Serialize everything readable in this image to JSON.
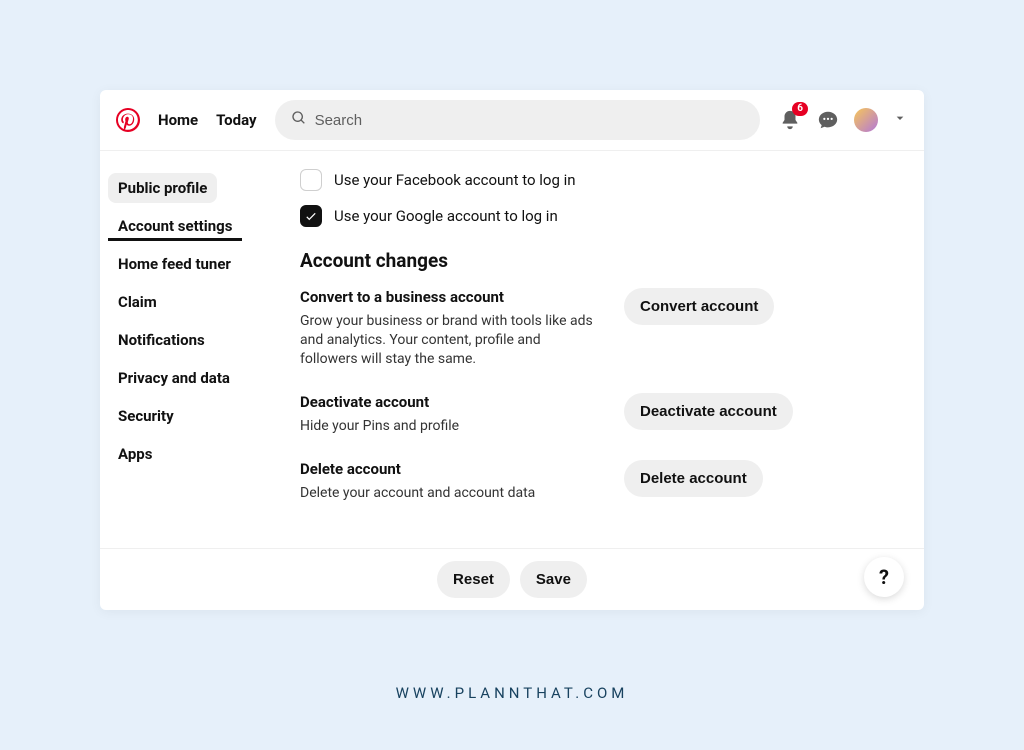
{
  "header": {
    "nav": {
      "home": "Home",
      "today": "Today"
    },
    "search_placeholder": "Search",
    "badge_count": "6"
  },
  "sidebar": {
    "items": [
      "Public profile",
      "Account settings",
      "Home feed tuner",
      "Claim",
      "Notifications",
      "Privacy and data",
      "Security",
      "Apps"
    ]
  },
  "login_options": {
    "facebook": "Use your Facebook account to log in",
    "google": "Use your Google account to log in"
  },
  "section_title": "Account changes",
  "actions": {
    "convert": {
      "title": "Convert to a business account",
      "desc": "Grow your business or brand with tools like ads and analytics. Your content, profile and followers will stay the same.",
      "button": "Convert account"
    },
    "deactivate": {
      "title": "Deactivate account",
      "desc": "Hide your Pins and profile",
      "button": "Deactivate account"
    },
    "delete": {
      "title": "Delete account",
      "desc": "Delete your account and account data",
      "button": "Delete account"
    }
  },
  "footer": {
    "reset": "Reset",
    "save": "Save",
    "help": "?"
  },
  "watermark": "WWW.PLANNTHAT.COM"
}
